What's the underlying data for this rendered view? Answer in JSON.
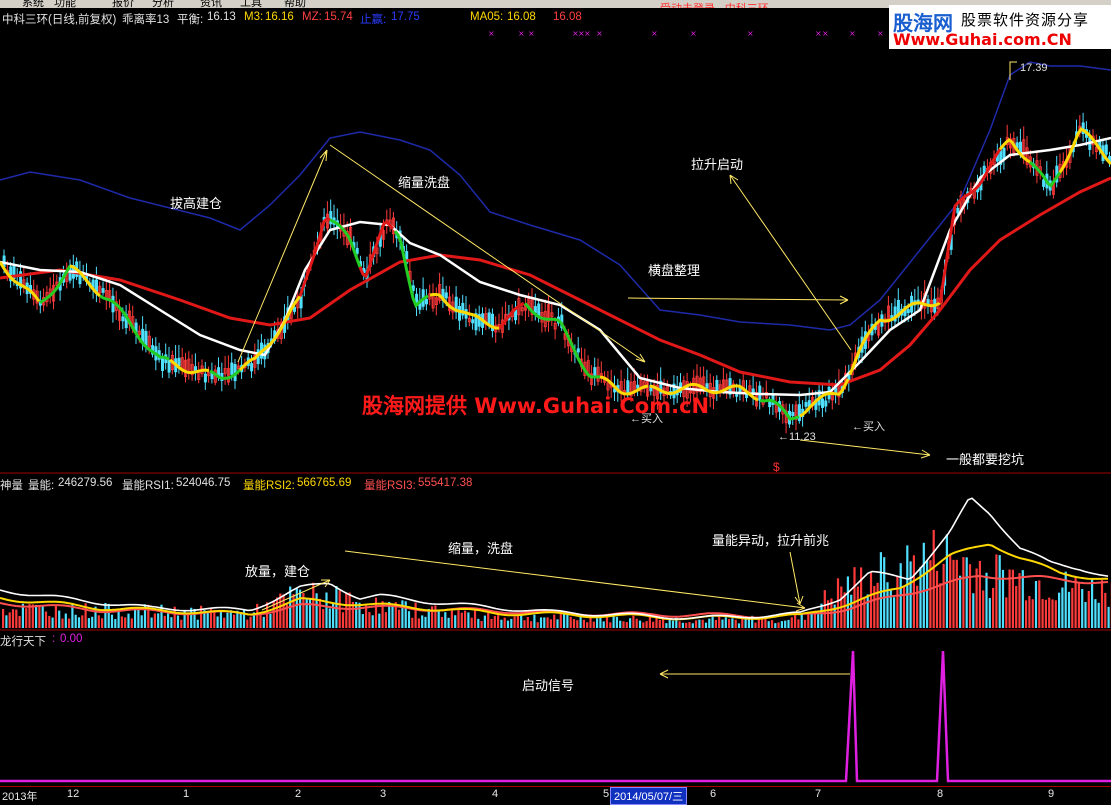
{
  "menu": [
    "系统",
    "功能",
    "报价",
    "分析",
    "资讯",
    "工具",
    "帮助"
  ],
  "banner": "受动未登录 - 中科三环",
  "header": {
    "title": "中科三环(日线,前复权)",
    "b": "乖离率13",
    "c_label": "平衡:",
    "c_val": "16.13",
    "m3_label": "M3:",
    "m3_val": "16.16",
    "mz_label": "MZ:",
    "mz_val": "15.74",
    "zy_label": "止赢:",
    "zy_val": "17.75",
    "ma_label": "MA05:",
    "ma_val": "16.08",
    "ma_val2": "16.08"
  },
  "logo": {
    "name": "股海网",
    "slogan": "股票软件资源分享",
    "url": "Www.Guhai.com.CN"
  },
  "price_annotations": {
    "a1": "拔高建仓",
    "a2": "缩量洗盘",
    "a3": "拉升启动",
    "a4": "横盘整理",
    "buy1": "←买入",
    "buy2": "←买入",
    "low": "←11.23",
    "high": "17.39",
    "a5": "一般都要挖坑"
  },
  "watermark": "股海网提供 Www.Guhai.Com.cN",
  "dollar": "$",
  "vol_header": {
    "name": "神量",
    "v1_label": "量能:",
    "v1": "246279.56",
    "v2_label": "量能RSI1:",
    "v2": "524046.75",
    "v3_label": "量能RSI2:",
    "v3": "566765.69",
    "v4_label": "量能RSI3:",
    "v4": "555417.38"
  },
  "vol_annotations": {
    "v1": "放量，建仓",
    "v2": "缩量，洗盘",
    "v3": "量能异动，拉升前兆"
  },
  "signal_header": {
    "name": "龙行天下",
    "val_label": ":",
    "val": "0.00"
  },
  "signal_annotation": "启动信号",
  "axis": {
    "ticks": [
      "2013年",
      "12",
      "1",
      "2",
      "3",
      "4",
      "5",
      "6",
      "7",
      "8",
      "9"
    ],
    "current_date": "2014/05/07/三"
  },
  "colors": {
    "ma_white": "#ffffff",
    "ma_red": "#e01818",
    "ma_yellow": "#ffd800",
    "ma_green": "#22cc22",
    "band_blue": "#1e2aa8",
    "up": "#ff3a3a",
    "down": "#50e0ff",
    "signal": "#e020e0",
    "divider": "#a00000"
  }
}
